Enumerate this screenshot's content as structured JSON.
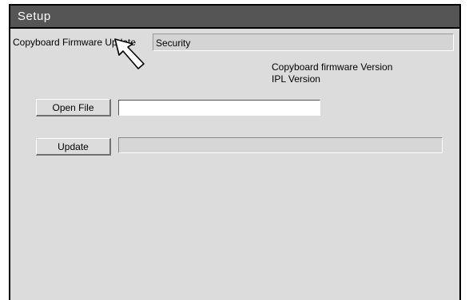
{
  "window": {
    "title": "Setup"
  },
  "tabs": [
    {
      "label": "Copyboard Firmware Update",
      "active": true
    },
    {
      "label": "Security",
      "active": false
    }
  ],
  "info": {
    "firmware_version_label": "Copyboard firmware Version",
    "ipl_version_label": "IPL Version"
  },
  "buttons": {
    "open_file": "Open File",
    "update": "Update"
  },
  "file_path": {
    "value": ""
  },
  "update_progress": {
    "fraction": 0
  },
  "icons": {
    "cursor": "mouse-pointer-icon"
  }
}
